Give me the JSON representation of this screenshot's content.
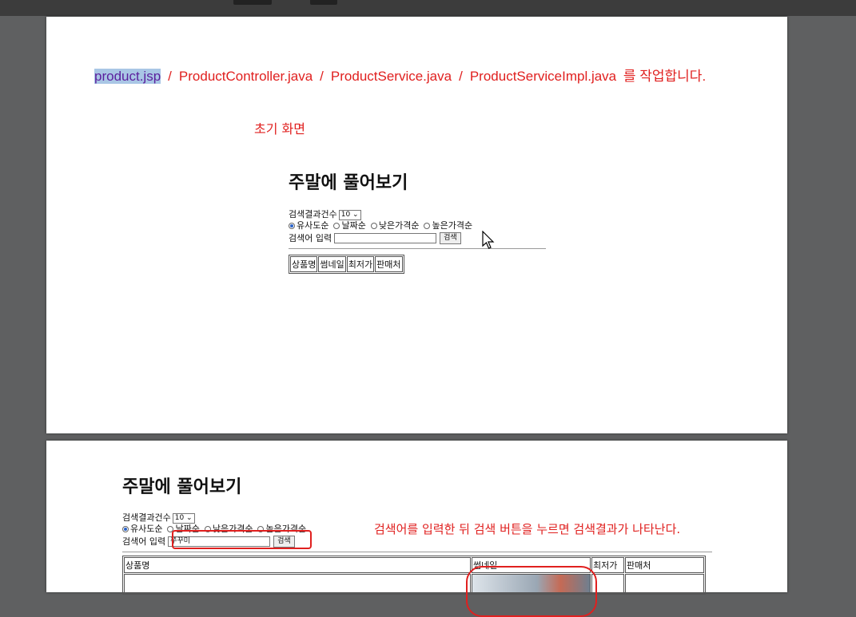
{
  "colors": {
    "annotation_red": "#e0201f",
    "highlight": "#a9c6e5"
  },
  "page1": {
    "files": [
      "product.jsp",
      "ProductController.java",
      "ProductService.java",
      "ProductServiceImpl.java"
    ],
    "separator": "/",
    "tail": "를 작업합니다.",
    "initial_label": "초기 화면",
    "form": {
      "title": "주말에 풀어보기",
      "count_label": "검색결과건수",
      "count_value": "10 ⌄",
      "sort_options": [
        "유사도순",
        "날짜순",
        "낮은가격순",
        "높은가격순"
      ],
      "search_label": "검색어 입력",
      "search_value": "",
      "search_button": "검색",
      "columns": [
        "상품명",
        "썸네일",
        "최저가",
        "판매처"
      ]
    },
    "cursor_icon": "arrow-cursor-icon"
  },
  "page2": {
    "form": {
      "title": "주말에 풀어보기",
      "count_label": "검색결과건수",
      "count_value": "10 ⌄",
      "sort_options": [
        "유사도순",
        "날짜순",
        "낮은가격순",
        "높은가격순"
      ],
      "search_label": "검색어 입력",
      "search_value": "쭈꾸미",
      "search_button": "검색",
      "columns": [
        "상품명",
        "썸네일",
        "최저가",
        "판매처"
      ]
    },
    "note": "검색어를 입력한 뒤 검색 버튼을 누르면 검색결과가 나타난다."
  }
}
